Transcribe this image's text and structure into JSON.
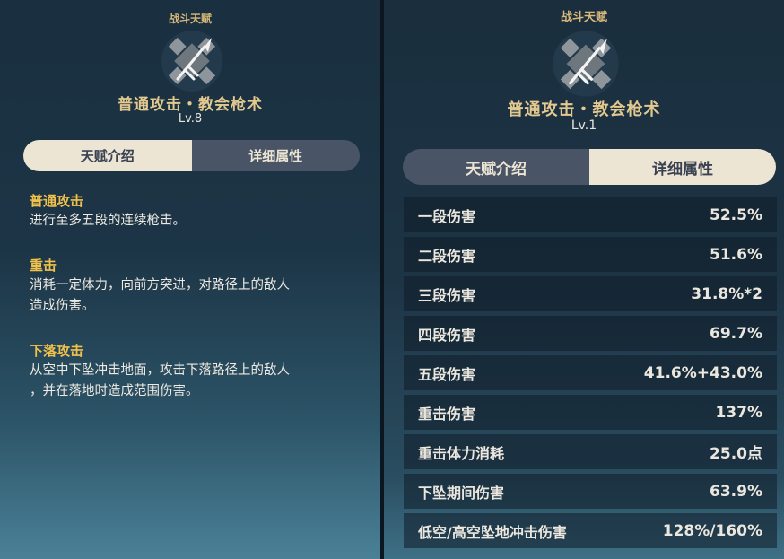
{
  "left": {
    "category": "战斗天赋",
    "icon": "spear-talent-icon",
    "skill_name": "普通攻击・教会枪术",
    "level": "Lv.8",
    "tabs": [
      "天赋介绍",
      "详细属性"
    ],
    "active_tab": "天赋介绍",
    "sections": [
      {
        "title": "普通攻击",
        "lines": [
          "进行至多五段的连续枪击。"
        ]
      },
      {
        "title": "重击",
        "lines": [
          "消耗一定体力，向前方突进，对路径上的敌人",
          "造成伤害。"
        ]
      },
      {
        "title": "下落攻击",
        "lines": [
          "从空中下坠冲击地面，攻击下落路径上的敌人",
          "，并在落地时造成范围伤害。"
        ]
      }
    ]
  },
  "right": {
    "category": "战斗天赋",
    "icon": "spear-talent-icon",
    "skill_name": "普通攻击・教会枪术",
    "level": "Lv.1",
    "tabs": [
      "天赋介绍",
      "详细属性"
    ],
    "active_tab": "详细属性",
    "attributes": [
      {
        "name": "一段伤害",
        "value": "52.5%"
      },
      {
        "name": "二段伤害",
        "value": "51.6%"
      },
      {
        "name": "三段伤害",
        "value": "31.8%*2"
      },
      {
        "name": "四段伤害",
        "value": "69.7%"
      },
      {
        "name": "五段伤害",
        "value": "41.6%+43.0%"
      },
      {
        "name": "重击伤害",
        "value": "137%"
      },
      {
        "name": "重击体力消耗",
        "value": "25.0点"
      },
      {
        "name": "下坠期间伤害",
        "value": "63.9%"
      },
      {
        "name": "低空/高空坠地冲击伤害",
        "value": "128%/160%"
      }
    ]
  },
  "colors": {
    "title_gold": "#e3c98f",
    "section_yellow": "#f0c14b",
    "tab_active_bg": "#ece5d3",
    "tab_inactive_bg": "#4a5467"
  }
}
